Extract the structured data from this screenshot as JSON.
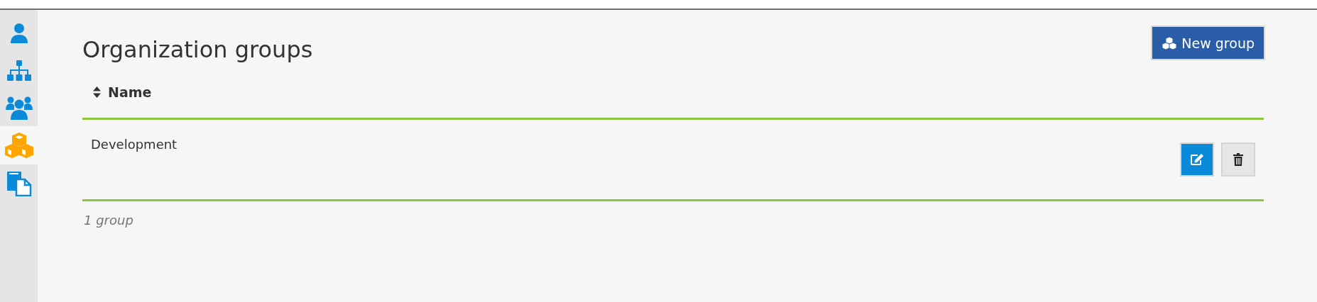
{
  "sidebar": {
    "items": [
      {
        "selected": false
      },
      {
        "selected": false
      },
      {
        "selected": false
      },
      {
        "selected": true
      },
      {
        "selected": false
      }
    ]
  },
  "title": "Organization groups",
  "new_button": {
    "label": "New group"
  },
  "table": {
    "columns": [
      {
        "label": "Name"
      }
    ],
    "rows": [
      {
        "name": "Development"
      }
    ]
  },
  "footer": "1 group"
}
